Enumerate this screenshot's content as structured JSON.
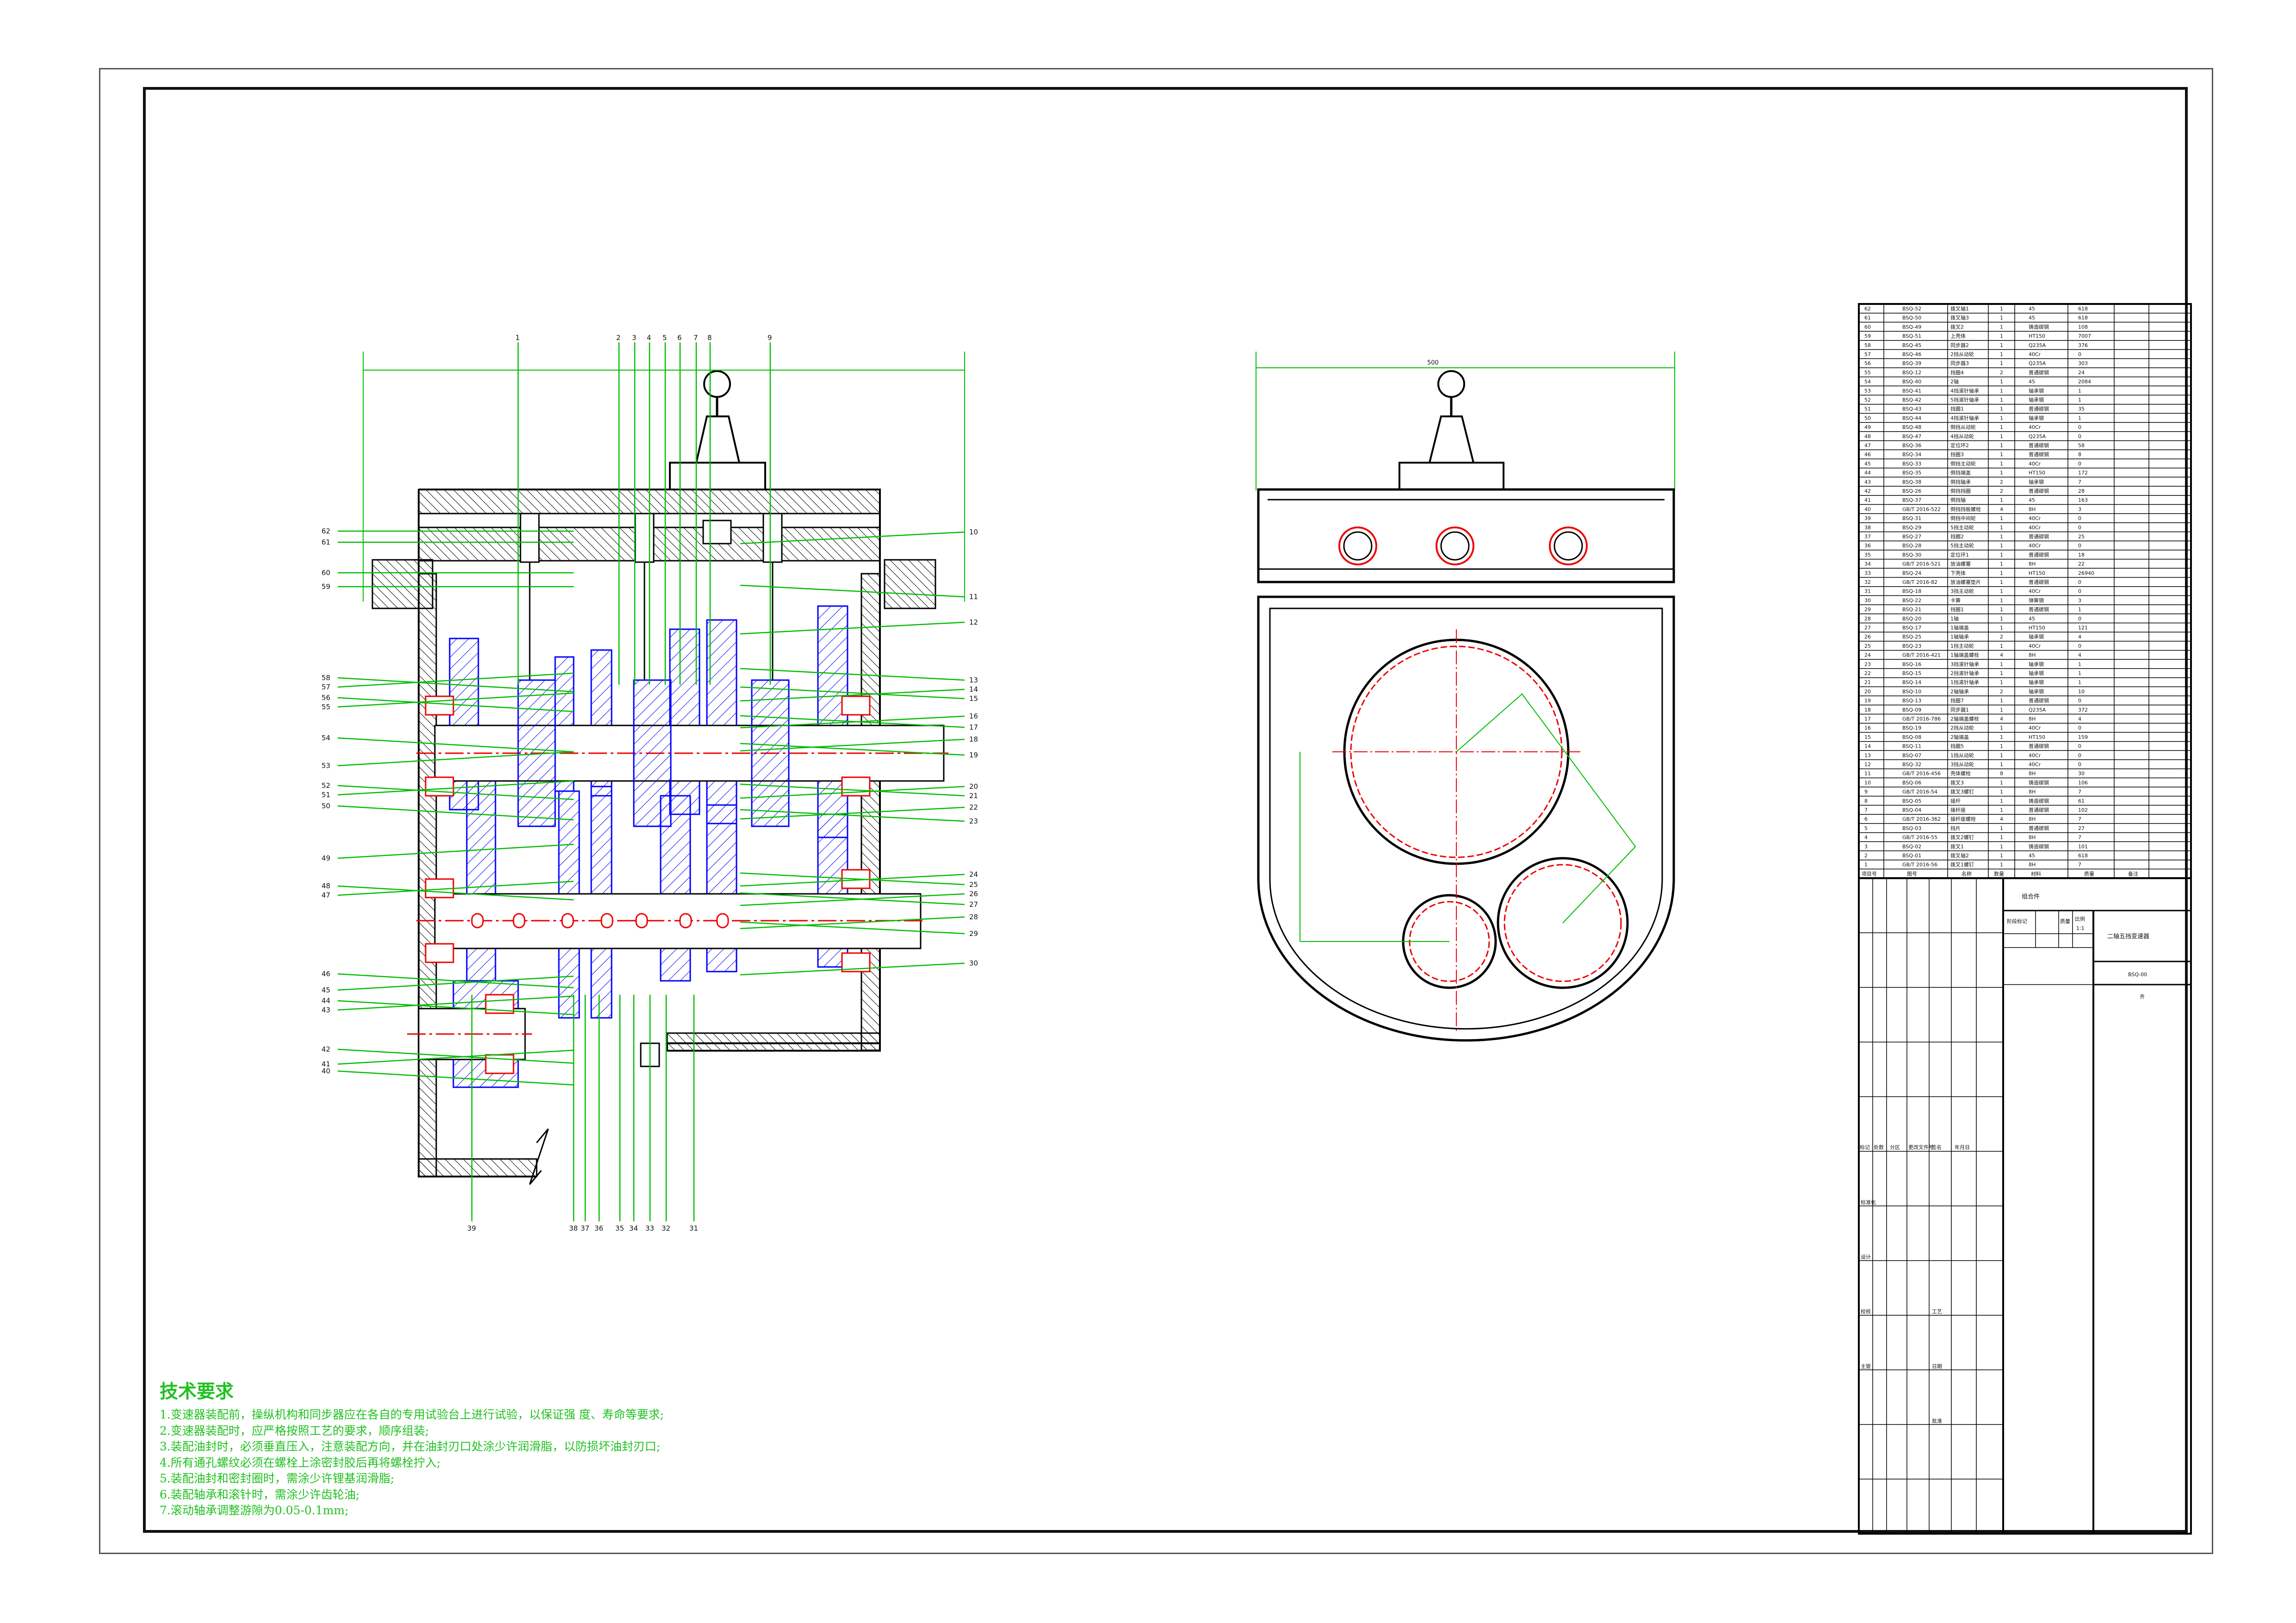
{
  "tech_title": "技术要求",
  "tech_lines": [
    "1.变速器装配前，操纵机构和同步器应在各自的专用试验台上进行试验，以保证强    度、寿命等要求;",
    "2.变速器装配时，应严格按照工艺的要求，顺序组装;",
    "3.装配油封时，必须垂直压入，注意装配方向，并在油封刃口处涂少许润滑脂，以防损坏油封刃口;",
    "4.所有通孔螺纹必须在螺栓上涂密封胶后再将螺栓拧入;",
    "5.装配油封和密封圈时，需涂少许锂基润滑脂;",
    "6.装配轴承和滚针时，需涂少许齿轮油;",
    "7.滚动轴承调整游隙为0.05-0.1mm;"
  ],
  "parts": [
    [
      "62",
      "BSQ-52",
      "拨叉轴1",
      "1",
      "45",
      "618"
    ],
    [
      "61",
      "BSQ-50",
      "拨叉轴3",
      "1",
      "45",
      "618"
    ],
    [
      "60",
      "BSQ-49",
      "拨叉2",
      "1",
      "铸造碳钢",
      "108"
    ],
    [
      "59",
      "BSQ-51",
      "上壳体",
      "1",
      "HT150",
      "7007"
    ],
    [
      "58",
      "BSQ-45",
      "同步器2",
      "1",
      "Q235A",
      "376"
    ],
    [
      "57",
      "BSQ-46",
      "2挡从动轮",
      "1",
      "40Cr",
      "0"
    ],
    [
      "56",
      "BSQ-39",
      "同步器3",
      "1",
      "Q235A",
      "303"
    ],
    [
      "55",
      "BSQ-12",
      "挡圈4",
      "2",
      "普通碳钢",
      "24"
    ],
    [
      "54",
      "BSQ-40",
      "2轴",
      "1",
      "45",
      "2084"
    ],
    [
      "53",
      "BSQ-41",
      "4挡滚针轴承",
      "1",
      "轴承钢",
      "1"
    ],
    [
      "52",
      "BSQ-42",
      "5挡滚针轴承",
      "1",
      "轴承钢",
      "1"
    ],
    [
      "51",
      "BSQ-43",
      "挡圈1",
      "1",
      "普通碳钢",
      "35"
    ],
    [
      "50",
      "BSQ-44",
      "4挡滚针轴承",
      "1",
      "轴承钢",
      "1"
    ],
    [
      "49",
      "BSQ-48",
      "倒挡从动轮",
      "1",
      "40Cr",
      "0"
    ],
    [
      "48",
      "BSQ-47",
      "4挡从动轮",
      "1",
      "Q235A",
      "0"
    ],
    [
      "47",
      "BSQ-36",
      "定位环2",
      "1",
      "普通碳钢",
      "58"
    ],
    [
      "46",
      "BSQ-34",
      "挡圈3",
      "1",
      "普通碳钢",
      "8"
    ],
    [
      "45",
      "BSQ-33",
      "倒挡主动轮",
      "1",
      "40Cr",
      "0"
    ],
    [
      "44",
      "BSQ-35",
      "倒挡端盖",
      "1",
      "HT150",
      "172"
    ],
    [
      "43",
      "BSQ-38",
      "倒挡轴承",
      "2",
      "轴承钢",
      "7"
    ],
    [
      "42",
      "BSQ-26",
      "倒挡挡圈",
      "2",
      "普通碳钢",
      "28"
    ],
    [
      "41",
      "BSQ-37",
      "倒挡轴",
      "1",
      "45",
      "163"
    ],
    [
      "40",
      "GB/T 2016-522",
      "倒挡挡板螺栓",
      "4",
      "8H",
      "3"
    ],
    [
      "39",
      "BSQ-31",
      "倒挡中间轮",
      "1",
      "40Cr",
      "0"
    ],
    [
      "38",
      "BSQ-29",
      "5挡主动轮",
      "1",
      "40Cr",
      "0"
    ],
    [
      "37",
      "BSQ-27",
      "挡圈2",
      "1",
      "普通碳钢",
      "25"
    ],
    [
      "36",
      "BSQ-28",
      "5挡主动轮",
      "1",
      "40Cr",
      "0"
    ],
    [
      "35",
      "BSQ-30",
      "定位环1",
      "1",
      "普通碳钢",
      "18"
    ],
    [
      "34",
      "GB/T 2016-521",
      "放油螺塞",
      "1",
      "8H",
      "22"
    ],
    [
      "33",
      "BSQ-24",
      "下壳体",
      "1",
      "HT150",
      "26940"
    ],
    [
      "32",
      "GB/T 2016-82",
      "放油螺塞垫片",
      "1",
      "普通碳钢",
      "0"
    ],
    [
      "31",
      "BSQ-18",
      "3挡主动轮",
      "1",
      "40Cr",
      "0"
    ],
    [
      "30",
      "BSQ-22",
      "卡簧",
      "1",
      "弹簧钢",
      "3"
    ],
    [
      "29",
      "BSQ-21",
      "挡圈1",
      "1",
      "普通碳钢",
      "1"
    ],
    [
      "28",
      "BSQ-20",
      "1轴",
      "1",
      "45",
      "0"
    ],
    [
      "27",
      "BSQ-17",
      "1轴端盖",
      "1",
      "HT150",
      "121"
    ],
    [
      "26",
      "BSQ-25",
      "1轴轴承",
      "2",
      "轴承钢",
      "4"
    ],
    [
      "25",
      "BSQ-23",
      "1挡主动轮",
      "1",
      "40Cr",
      "0"
    ],
    [
      "24",
      "GB/T 2016-421",
      "1轴端盖螺栓",
      "4",
      "8H",
      "4"
    ],
    [
      "23",
      "BSQ-16",
      "3挡滚针轴承",
      "1",
      "轴承钢",
      "1"
    ],
    [
      "22",
      "BSQ-15",
      "2挡滚针轴承",
      "1",
      "轴承钢",
      "1"
    ],
    [
      "21",
      "BSQ-14",
      "1挡滚针轴承",
      "1",
      "轴承钢",
      "1"
    ],
    [
      "20",
      "BSQ-10",
      "2轴轴承",
      "2",
      "轴承钢",
      "10"
    ],
    [
      "19",
      "BSQ-13",
      "挡圈7",
      "1",
      "普通碳钢",
      "0"
    ],
    [
      "18",
      "BSQ-09",
      "同步器1",
      "1",
      "Q235A",
      "372"
    ],
    [
      "17",
      "GB/T 2016-786",
      "2轴端盖螺栓",
      "4",
      "8H",
      "4"
    ],
    [
      "16",
      "BSQ-19",
      "2挡从动轮",
      "1",
      "40Cr",
      "0"
    ],
    [
      "15",
      "BSQ-08",
      "2轴端盖",
      "1",
      "HT150",
      "159"
    ],
    [
      "14",
      "BSQ-11",
      "挡圈5",
      "1",
      "普通碳钢",
      "0"
    ],
    [
      "13",
      "BSQ-07",
      "1挡从动轮",
      "1",
      "40Cr",
      "0"
    ],
    [
      "12",
      "BSQ-32",
      "3挡从动轮",
      "1",
      "40Cr",
      "0"
    ],
    [
      "11",
      "GB/T 2016-456",
      "壳体螺栓",
      "8",
      "8H",
      "30"
    ],
    [
      "10",
      "BSQ-06",
      "拨叉3",
      "1",
      "铸造碳钢",
      "106"
    ],
    [
      "9",
      "GB/T 2016-54",
      "拨叉3螺钉",
      "1",
      "8H",
      "7"
    ],
    [
      "8",
      "BSQ-05",
      "操杆",
      "1",
      "铸造碳钢",
      "61"
    ],
    [
      "7",
      "BSQ-04",
      "操杆座",
      "1",
      "普通碳钢",
      "102"
    ],
    [
      "6",
      "GB/T 2016-362",
      "操杆座螺栓",
      "4",
      "8H",
      "7"
    ],
    [
      "5",
      "BSQ-03",
      "挡片",
      "1",
      "普通碳钢",
      "27"
    ],
    [
      "4",
      "GB/T 2016-55",
      "拨叉2螺钉",
      "1",
      "8H",
      "7"
    ],
    [
      "3",
      "BSQ-02",
      "拨叉1",
      "1",
      "铸造碳钢",
      "101"
    ],
    [
      "2",
      "BSQ-01",
      "拨叉轴2",
      "1",
      "45",
      "618"
    ],
    [
      "1",
      "GB/T 2016-56",
      "拨叉1螺钉",
      "1",
      "8H",
      "7"
    ]
  ],
  "parts_header": [
    "项目号",
    "图号",
    "名称",
    "数量",
    "材料",
    "质量",
    "备注"
  ],
  "title_block": {
    "assembly": "组合件",
    "name": "二轴五挡变速器",
    "drawing_no": "BSQ-00",
    "scale_label": "比例",
    "scale": "1:1",
    "stage_label": "阶段标记",
    "weight_label": "质量",
    "company": "齐",
    "row_headers": [
      "标记",
      "处数",
      "分区",
      "更改文件号",
      "签名",
      "年月日"
    ],
    "roles": [
      "设计",
      "校核",
      "主管"
    ],
    "roles2": [
      "工艺",
      "日期",
      "批准"
    ],
    "std_label": "标准化"
  },
  "front_top_labels": [
    "1",
    "2",
    "3",
    "4",
    "5",
    "6",
    "7",
    "8",
    "9"
  ],
  "front_left_labels": [
    "62",
    "61",
    "60",
    "59",
    "58",
    "57",
    "56",
    "55",
    "54",
    "53",
    "52",
    "51",
    "50",
    "49",
    "48",
    "47",
    "46",
    "45",
    "44",
    "43",
    "42",
    "41",
    "40"
  ],
  "front_right_labels": [
    "10",
    "11",
    "12",
    "13",
    "14",
    "15",
    "16",
    "17",
    "18",
    "19",
    "20",
    "21",
    "22",
    "23",
    "24",
    "25",
    "26",
    "27",
    "28",
    "29",
    "30"
  ],
  "front_bottom_labels": [
    "39",
    "38",
    "37",
    "36",
    "35",
    "34",
    "33",
    "32",
    "31"
  ],
  "side_width_dim": "500",
  "colors": {
    "blue": "#0000ff",
    "green": "#00bb00",
    "red": "#ee0000",
    "line": "#000000"
  }
}
